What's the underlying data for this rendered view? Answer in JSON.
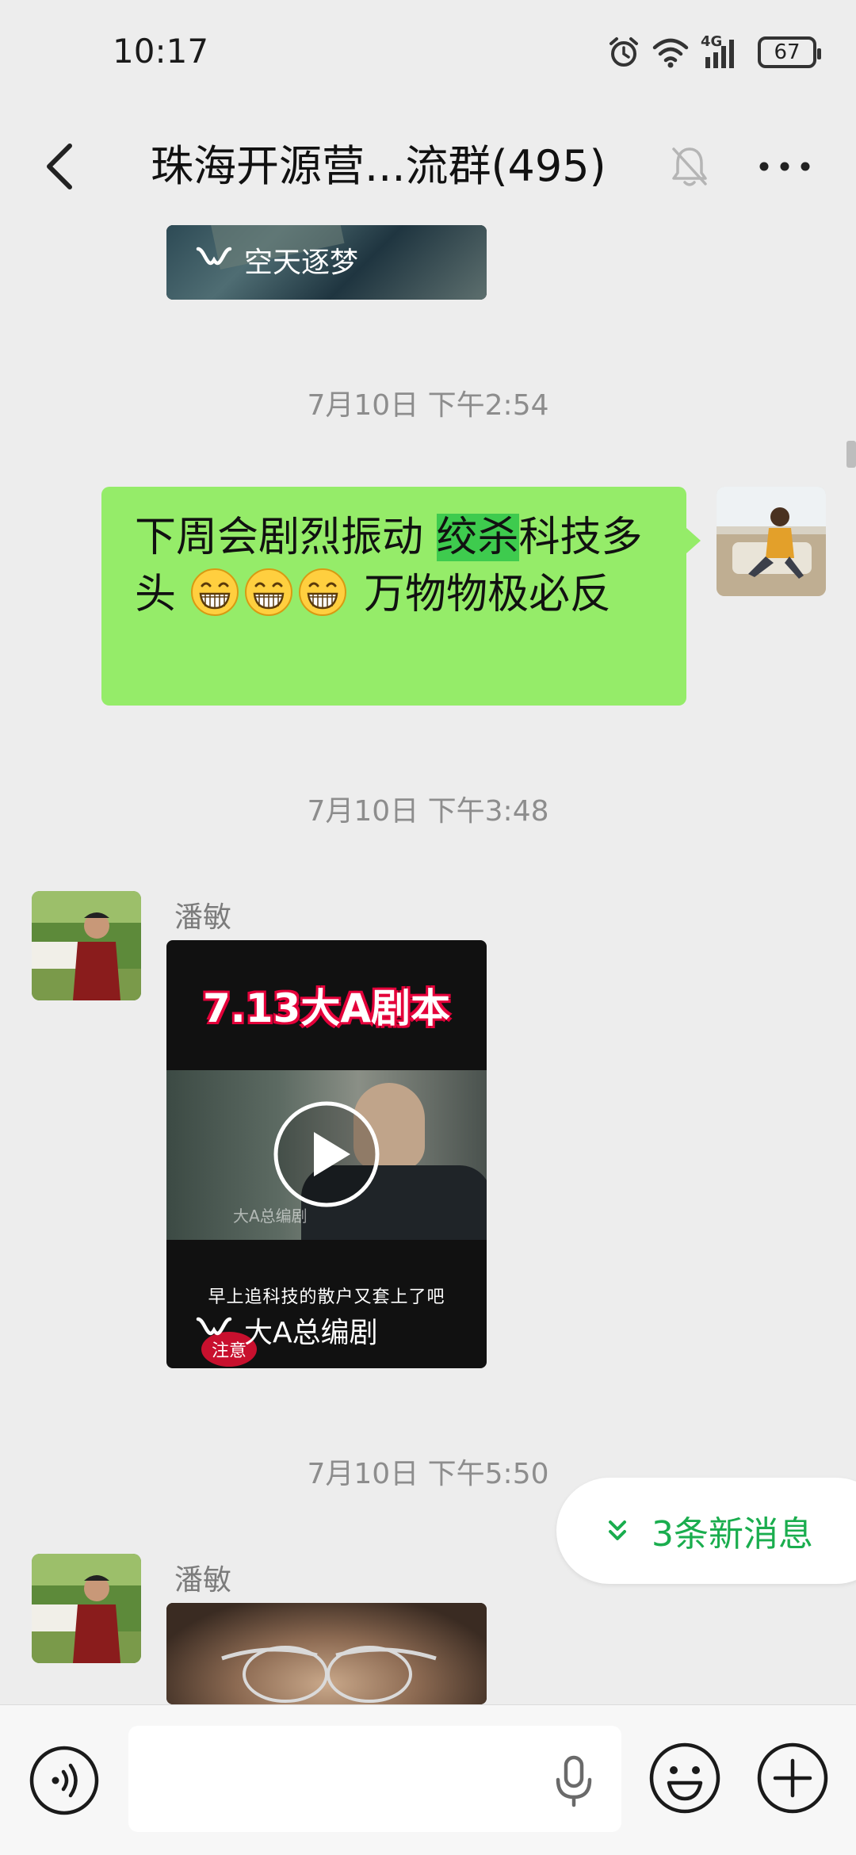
{
  "status_bar": {
    "time": "10:17",
    "network": "4G",
    "battery": "67"
  },
  "header": {
    "title": "珠海开源营...流群(495)"
  },
  "messages": {
    "top_card": {
      "channel": "空天逐梦"
    },
    "ts1": "7月10日 下午2:54",
    "outgoing": {
      "part1": "下周会剧烈振动 ",
      "highlight": "绞杀",
      "part2": "科技多头 ",
      "part3": "  万物物极必反"
    },
    "ts2": "7月10日 下午3:48",
    "msg2": {
      "sender": "潘敏",
      "video_title": "7.13大A剧本",
      "watermark": "大A总编剧",
      "subtitle": "早上追科技的散户又套上了吧",
      "channel": "大A总编剧",
      "badge": "注意"
    },
    "ts3": "7月10日 下午5:50",
    "msg3": {
      "sender": "潘敏"
    }
  },
  "new_messages": {
    "label": "3条新消息"
  },
  "input": {
    "placeholder": ""
  },
  "colors": {
    "bubble_out": "#95ec69",
    "highlight": "#3ecb4e",
    "accent": "#1aad4e",
    "background": "#ededed",
    "title_red": "#e4003a"
  },
  "icons": [
    "back-icon",
    "mute-bell-icon",
    "more-icon",
    "video-channel-icon",
    "play-icon",
    "chevron-double-down-icon",
    "voice-icon",
    "mic-icon",
    "emoji-icon",
    "plus-icon",
    "grin-emoji"
  ]
}
